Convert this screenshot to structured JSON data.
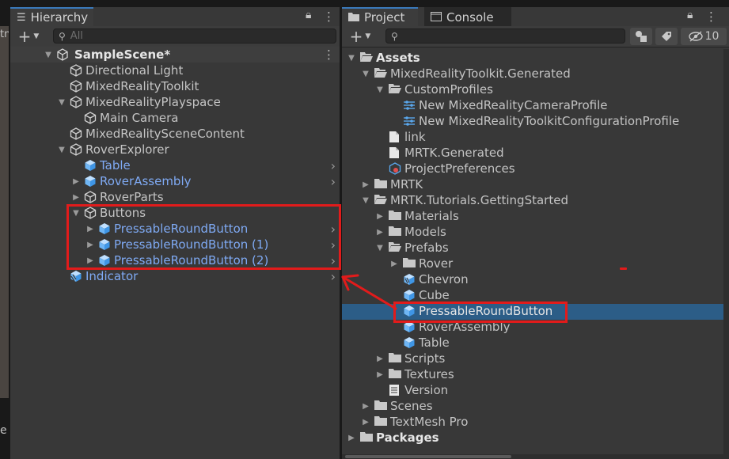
{
  "hierarchy": {
    "tab_label": "Hierarchy",
    "search_placeholder": "All",
    "scene": "SampleScene*",
    "items": [
      {
        "label": "Directional Light"
      },
      {
        "label": "MixedRealityToolkit"
      },
      {
        "label": "MixedRealityPlayspace"
      },
      {
        "label": "Main Camera"
      },
      {
        "label": "MixedRealitySceneContent"
      },
      {
        "label": "RoverExplorer"
      },
      {
        "label": "Table"
      },
      {
        "label": "RoverAssembly"
      },
      {
        "label": "RoverParts"
      },
      {
        "label": "Buttons"
      },
      {
        "label": "PressableRoundButton"
      },
      {
        "label": "PressableRoundButton (1)"
      },
      {
        "label": "PressableRoundButton (2)"
      },
      {
        "label": "Indicator"
      }
    ]
  },
  "project": {
    "tabs": [
      {
        "label": "Project"
      },
      {
        "label": "Console"
      }
    ],
    "hidden_count": "10",
    "items": [
      {
        "label": "Assets"
      },
      {
        "label": "MixedRealityToolkit.Generated"
      },
      {
        "label": "CustomProfiles"
      },
      {
        "label": "New MixedRealityCameraProfile"
      },
      {
        "label": "New MixedRealityToolkitConfigurationProfile"
      },
      {
        "label": "link"
      },
      {
        "label": "MRTK.Generated"
      },
      {
        "label": "ProjectPreferences"
      },
      {
        "label": "MRTK"
      },
      {
        "label": "MRTK.Tutorials.GettingStarted"
      },
      {
        "label": "Materials"
      },
      {
        "label": "Models"
      },
      {
        "label": "Prefabs"
      },
      {
        "label": "Rover"
      },
      {
        "label": "Chevron"
      },
      {
        "label": "Cube"
      },
      {
        "label": "PressableRoundButton"
      },
      {
        "label": "RoverAssembly"
      },
      {
        "label": "Table"
      },
      {
        "label": "Scripts"
      },
      {
        "label": "Textures"
      },
      {
        "label": "Version"
      },
      {
        "label": "Scenes"
      },
      {
        "label": "TextMesh Pro"
      },
      {
        "label": "Packages"
      }
    ]
  },
  "left_edge": {
    "tab_fragment": "tn",
    "bottom_fragment": "e"
  },
  "colors": {
    "annotation": "#e21b1b",
    "selection": "#2c5d87",
    "prefab_text": "#7faaf4"
  }
}
